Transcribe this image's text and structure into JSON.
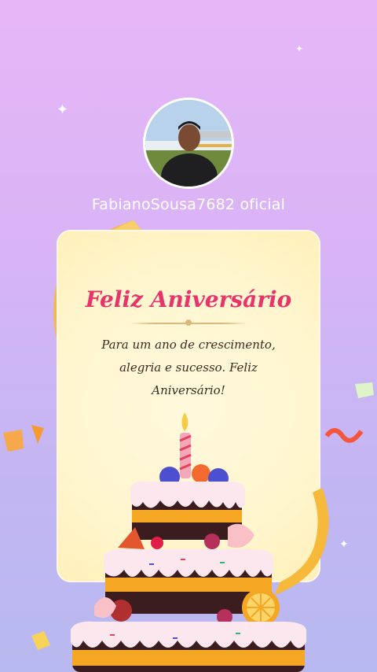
{
  "profile": {
    "username": "FabianoSousa7682 oficial"
  },
  "card": {
    "title": "Feliz Aniversário",
    "message": "Para um ano de crescimento, alegria e sucesso. Feliz Aniversário!"
  },
  "colors": {
    "title": "#e8336b",
    "background_top": "#e7b6f7",
    "background_bottom": "#b8b9f0",
    "card": "#fff6cf"
  },
  "icons": [
    "sparkle-icon",
    "ribbon-icon",
    "confetti-icon",
    "cake-icon",
    "candle-icon"
  ]
}
